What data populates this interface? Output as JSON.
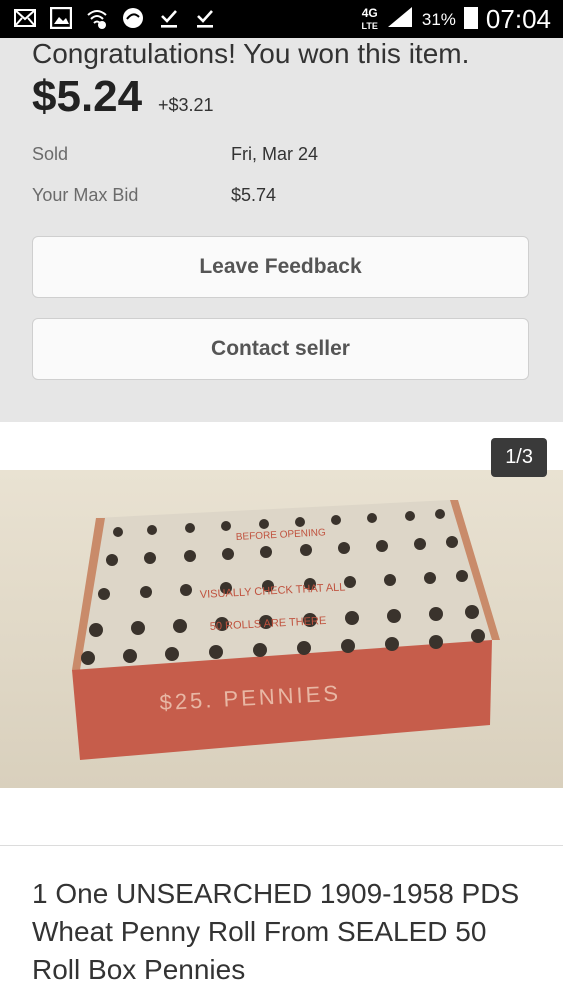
{
  "status_bar": {
    "network": "4G",
    "network_sub": "LTE",
    "battery": "31%",
    "time": "07:04"
  },
  "purchase": {
    "congrats": "Congratulations! You won this item.",
    "price": "$5.24",
    "shipping": "+$3.21",
    "rows": [
      {
        "label": "Sold",
        "value": "Fri, Mar 24"
      },
      {
        "label": "Your Max Bid",
        "value": "$5.74"
      }
    ],
    "leave_feedback": "Leave Feedback",
    "contact_seller": "Contact seller"
  },
  "gallery": {
    "counter": "1/3",
    "box_text": {
      "line1": "BEFORE OPENING",
      "line2": "VISUALLY CHECK THAT ALL",
      "line3": "50 ROLLS ARE THERE",
      "label": "$25. PENNIES"
    }
  },
  "item": {
    "title": "1 One UNSEARCHED 1909-1958 PDS Wheat Penny Roll From SEALED 50 Roll Box Pennies"
  },
  "colors": {
    "panel_bg": "#e6e6e6",
    "box_red": "#c65d4b",
    "box_top": "#ddd6c8"
  }
}
